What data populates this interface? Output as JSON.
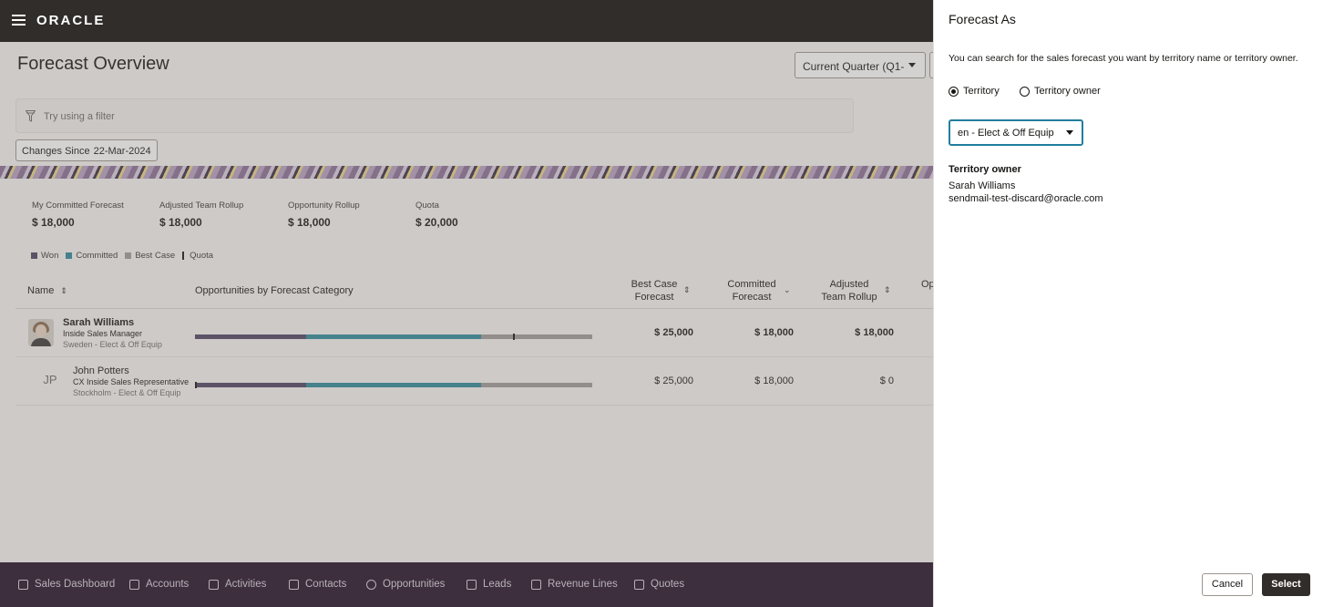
{
  "header": {
    "logo": "ORACLE"
  },
  "page": {
    "title": "Forecast Overview",
    "period_select": "Current Quarter (Q1-",
    "filter_placeholder": "Try using a filter",
    "changes_chip": {
      "label": "Changes Since",
      "value": "22-Mar-2024"
    }
  },
  "metrics": [
    {
      "label": "My Committed Forecast",
      "value": "$ 18,000"
    },
    {
      "label": "Adjusted Team Rollup",
      "value": "$ 18,000"
    },
    {
      "label": "Opportunity Rollup",
      "value": "$ 18,000"
    },
    {
      "label": "Quota",
      "value": "$ 20,000"
    }
  ],
  "legend": [
    {
      "label": "Won",
      "color": "#4f4563"
    },
    {
      "label": "Committed",
      "color": "#2f8a9a"
    },
    {
      "label": "Best Case",
      "color": "#9e9b98"
    },
    {
      "label": "Quota",
      "color": "#161513"
    }
  ],
  "table": {
    "columns": {
      "name": "Name",
      "opportunities": "Opportunities by Forecast Category",
      "best_case_1": "Best Case",
      "best_case_2": "Forecast",
      "committed_1": "Committed",
      "committed_2": "Forecast",
      "adjusted_1": "Adjusted",
      "adjusted_2": "Team Rollup",
      "cut": "Op"
    },
    "rows": [
      {
        "name": "Sarah Williams",
        "role": "Inside Sales Manager",
        "location": "Sweden - Elect & Off Equip",
        "avatar": "photo",
        "best_case": "$ 25,000",
        "committed": "$ 18,000",
        "adjusted": "$ 18,000",
        "bar": {
          "won": 0.28,
          "committed": 0.44,
          "best_case": 0.28,
          "quota": 0.8
        }
      },
      {
        "name": "John Potters",
        "initials": "JP",
        "role": "CX Inside Sales Representative",
        "location": "Stockholm - Elect & Off Equip",
        "best_case": "$ 25,000",
        "committed": "$ 18,000",
        "adjusted": "$ 0",
        "bar": {
          "won": 0.28,
          "committed": 0.44,
          "best_case": 0.28,
          "quota": 0.0
        }
      }
    ]
  },
  "bottom_nav": [
    {
      "label": "Sales Dashboard",
      "icon": "dashboard-icon"
    },
    {
      "label": "Accounts",
      "icon": "building-icon"
    },
    {
      "label": "Activities",
      "icon": "calendar-icon"
    },
    {
      "label": "Contacts",
      "icon": "contact-card-icon"
    },
    {
      "label": "Opportunities",
      "icon": "coin-icon"
    },
    {
      "label": "Leads",
      "icon": "handshake-icon"
    },
    {
      "label": "Revenue Lines",
      "icon": "cart-icon"
    },
    {
      "label": "Quotes",
      "icon": "document-icon"
    }
  ],
  "drawer": {
    "title": "Forecast As",
    "description": "You can search for the sales forecast you want by territory name or territory owner.",
    "radio_territory": "Territory",
    "radio_owner": "Territory owner",
    "selected_radio": "territory",
    "territory_value": "en - Elect & Off Equip",
    "owner_heading": "Territory owner",
    "owner_name": "Sarah Williams",
    "owner_email": "sendmail-test-discard@oracle.com",
    "cancel_label": "Cancel",
    "select_label": "Select"
  }
}
